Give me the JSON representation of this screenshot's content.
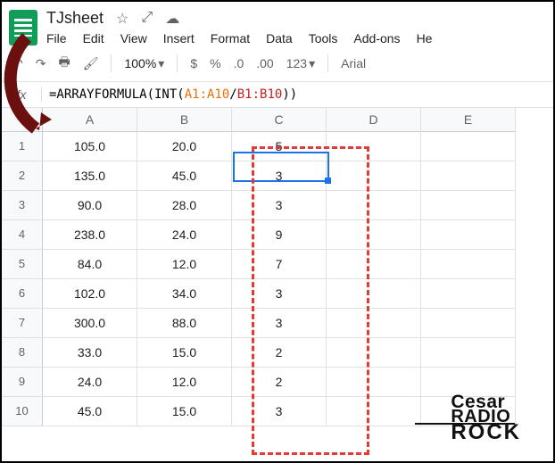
{
  "header": {
    "title": "TJsheet",
    "icons": {
      "star": "☆",
      "move": "⤢",
      "cloud": "☁"
    }
  },
  "menu": [
    "File",
    "Edit",
    "View",
    "Insert",
    "Format",
    "Data",
    "Tools",
    "Add-ons",
    "He"
  ],
  "toolbar": {
    "undo": "↶",
    "redo": "↷",
    "print": "🖶",
    "paint": "🖌",
    "zoom": "100%",
    "cur": "$",
    "pct": "%",
    "dec0": ".0",
    "dec00": ".00",
    "fmt": "123",
    "font": "Arial"
  },
  "formulaBar": {
    "fx": "fx",
    "p1": "=ARRAYFORMULA(INT(",
    "p2": "A1:A10",
    "p3": "/",
    "p4": "B1:B10",
    "p5": "))"
  },
  "columns": [
    "A",
    "B",
    "C",
    "D",
    "E"
  ],
  "rows": [
    {
      "n": "1",
      "c": [
        "105.0",
        "20.0",
        "5",
        "",
        ""
      ]
    },
    {
      "n": "2",
      "c": [
        "135.0",
        "45.0",
        "3",
        "",
        ""
      ]
    },
    {
      "n": "3",
      "c": [
        "90.0",
        "28.0",
        "3",
        "",
        ""
      ]
    },
    {
      "n": "4",
      "c": [
        "238.0",
        "24.0",
        "9",
        "",
        ""
      ]
    },
    {
      "n": "5",
      "c": [
        "84.0",
        "12.0",
        "7",
        "",
        ""
      ]
    },
    {
      "n": "6",
      "c": [
        "102.0",
        "34.0",
        "3",
        "",
        ""
      ]
    },
    {
      "n": "7",
      "c": [
        "300.0",
        "88.0",
        "3",
        "",
        ""
      ]
    },
    {
      "n": "8",
      "c": [
        "33.0",
        "15.0",
        "2",
        "",
        ""
      ]
    },
    {
      "n": "9",
      "c": [
        "24.0",
        "12.0",
        "2",
        "",
        ""
      ]
    },
    {
      "n": "10",
      "c": [
        "45.0",
        "15.0",
        "3",
        "",
        ""
      ]
    }
  ],
  "watermark": {
    "l1": "Cesar",
    "l2": "RADIO",
    "l3": "ROCK"
  }
}
